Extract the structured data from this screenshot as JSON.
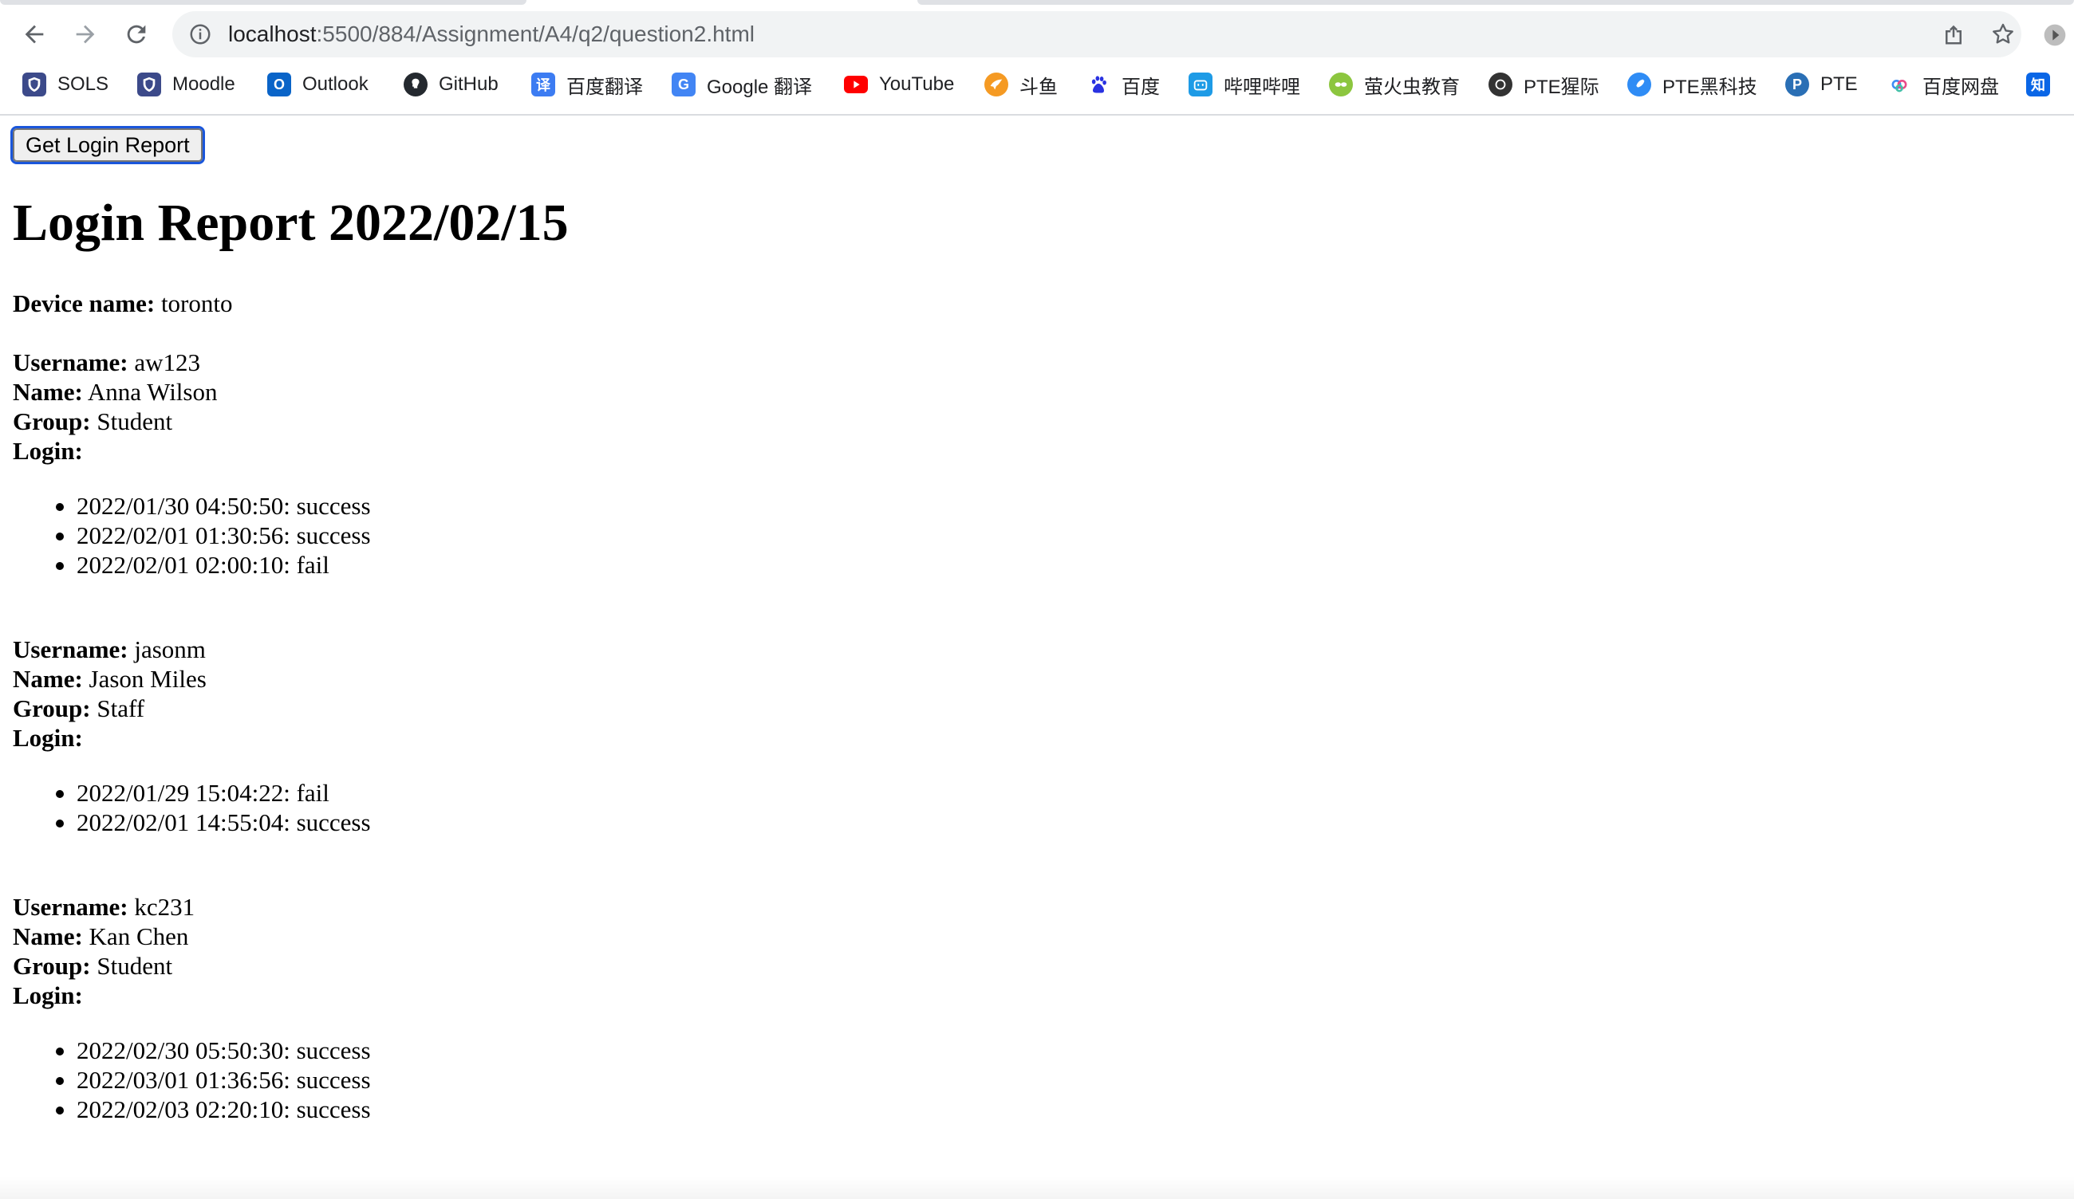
{
  "browser": {
    "url_host": "localhost",
    "url_path": ":5500/884/Assignment/A4/q2/question2.html",
    "bookmarks": [
      {
        "label": "SOLS",
        "icon": "shield-icon",
        "color": "#3c4a8a"
      },
      {
        "label": "Moodle",
        "icon": "shield-icon",
        "color": "#3c4a8a"
      },
      {
        "label": "Outlook",
        "icon": "outlook-icon",
        "color": "#0a64c8"
      },
      {
        "label": "GitHub",
        "icon": "github-icon",
        "color": "#24292f"
      },
      {
        "label": "百度翻译",
        "icon": "translate-icon",
        "color": "#3c7cf2"
      },
      {
        "label": "Google 翻译",
        "icon": "google-translate-icon",
        "color": "#4285f4"
      },
      {
        "label": "YouTube",
        "icon": "youtube-icon",
        "color": "#ff0000"
      },
      {
        "label": "斗鱼",
        "icon": "douyu-icon",
        "color": "#f59a23"
      },
      {
        "label": "百度",
        "icon": "baidu-paw-icon",
        "color": "#2932e1"
      },
      {
        "label": "哔哩哔哩",
        "icon": "bilibili-icon",
        "color": "#1e9be6"
      },
      {
        "label": "萤火虫教育",
        "icon": "firefly-icon",
        "color": "#8cc63f"
      },
      {
        "label": "PTE猩际",
        "icon": "pte-circle-icon",
        "color": "#333333"
      },
      {
        "label": "PTE黑科技",
        "icon": "pte-rocket-icon",
        "color": "#2f8cf5"
      },
      {
        "label": "PTE",
        "icon": "pte-p-icon",
        "color": "#2a6fb5"
      },
      {
        "label": "百度网盘",
        "icon": "cloud-drive-icon",
        "color": "#3d8cf5"
      },
      {
        "label": "知",
        "icon": "zhihu-icon",
        "color": "#0a66e6"
      }
    ]
  },
  "page": {
    "button_label": "Get Login Report",
    "title": "Login Report 2022/02/15",
    "device_label": "Device name:",
    "device_value": "toronto",
    "labels": {
      "username": "Username:",
      "name": "Name:",
      "group": "Group:",
      "login": "Login:"
    },
    "users": [
      {
        "username": "aw123",
        "name": "Anna Wilson",
        "group": "Student",
        "logins": [
          "2022/01/30 04:50:50: success",
          "2022/02/01 01:30:56: success",
          "2022/02/01 02:00:10: fail"
        ]
      },
      {
        "username": "jasonm",
        "name": "Jason Miles",
        "group": "Staff",
        "logins": [
          "2022/01/29 15:04:22: fail",
          "2022/02/01 14:55:04: success"
        ]
      },
      {
        "username": "kc231",
        "name": "Kan Chen",
        "group": "Student",
        "logins": [
          "2022/02/30 05:50:30: success",
          "2022/03/01 01:36:56: success",
          "2022/02/03 02:20:10: success"
        ]
      }
    ]
  }
}
